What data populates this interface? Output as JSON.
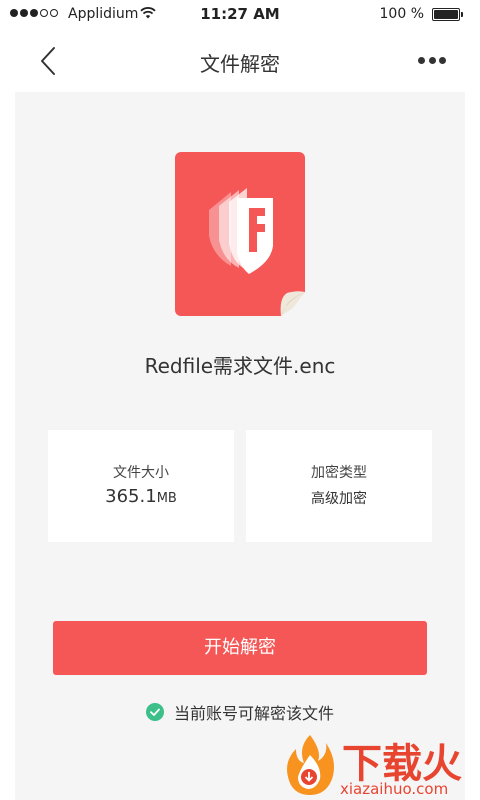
{
  "status_bar": {
    "carrier": "Applidium",
    "time": "11:27 AM",
    "battery": "100 %"
  },
  "nav": {
    "title": "文件解密",
    "back_icon": "chevron-left-icon",
    "more_icon": "more-horizontal-icon"
  },
  "file": {
    "name": "Redfile需求文件.enc",
    "icon": "encrypted-file-icon",
    "icon_color": "#f55656"
  },
  "info": {
    "size_label": "文件大小",
    "size_value": "365.1",
    "size_unit": "MB",
    "type_label": "加密类型",
    "type_value": "高级加密"
  },
  "actions": {
    "decrypt_label": "开始解密",
    "button_color": "#f55656"
  },
  "note": {
    "text": "当前账号可解密该文件",
    "icon": "check-circle-icon",
    "icon_color": "#3cbf88"
  },
  "watermark": {
    "text": "下载火",
    "url": "xiazaihuo.com"
  }
}
